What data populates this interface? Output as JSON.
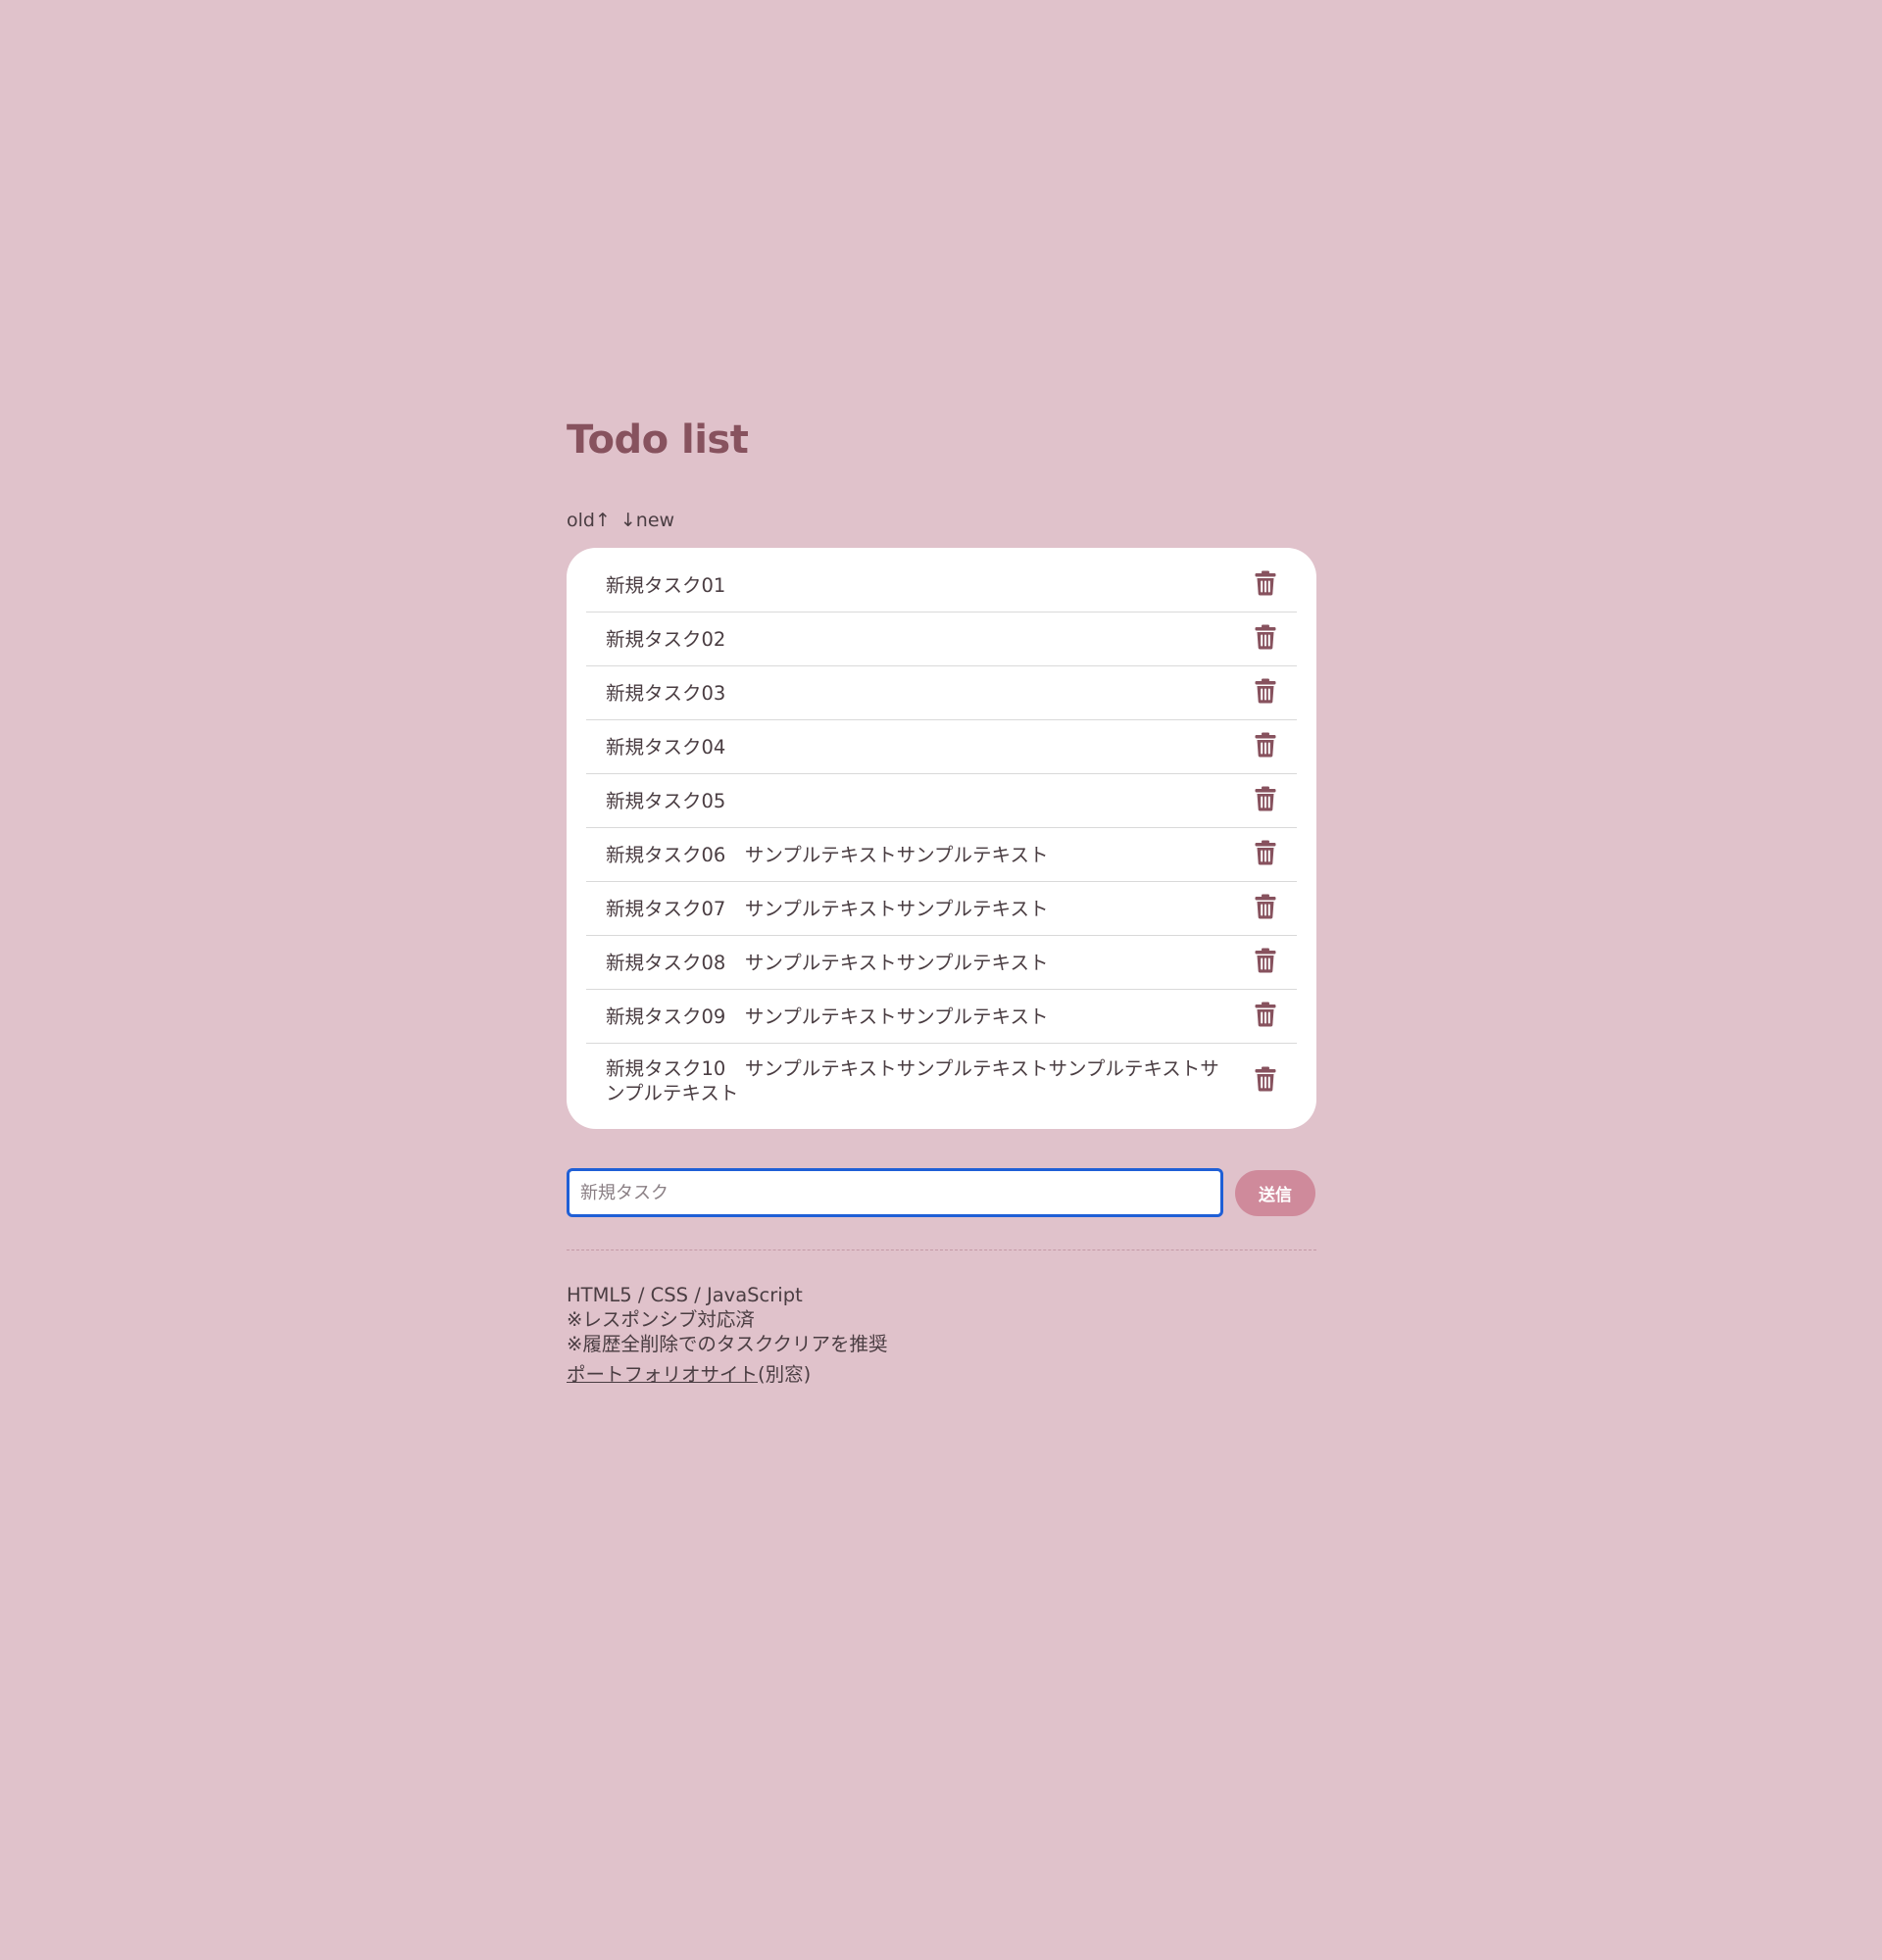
{
  "header": {
    "title": "Todo list"
  },
  "sort": {
    "old_label": "old↑",
    "new_label": "↓new"
  },
  "tasks": [
    {
      "text": "新規タスク01"
    },
    {
      "text": "新規タスク02"
    },
    {
      "text": "新規タスク03"
    },
    {
      "text": "新規タスク04"
    },
    {
      "text": "新規タスク05"
    },
    {
      "text": "新規タスク06　サンプルテキストサンプルテキスト"
    },
    {
      "text": "新規タスク07　サンプルテキストサンプルテキスト"
    },
    {
      "text": "新規タスク08　サンプルテキストサンプルテキスト"
    },
    {
      "text": "新規タスク09　サンプルテキストサンプルテキスト"
    },
    {
      "text": "新規タスク10　サンプルテキストサンプルテキストサンプルテキストサンプルテキスト"
    }
  ],
  "icons": {
    "delete": "trash-icon"
  },
  "form": {
    "placeholder": "新規タスク",
    "value": "",
    "submit_label": "送信"
  },
  "footer": {
    "tech": "HTML5 / CSS / JavaScript",
    "note1": "※レスポンシブ対応済",
    "note2": "※履歴全削除でのタスククリアを推奨",
    "link_label": "ポートフォリオサイト",
    "link_suffix": "(別窓)"
  },
  "colors": {
    "background": "#e0c2cb",
    "accent": "#87525e",
    "button": "#cf8a9b",
    "card": "#ffffff",
    "text": "#4a3d42"
  }
}
